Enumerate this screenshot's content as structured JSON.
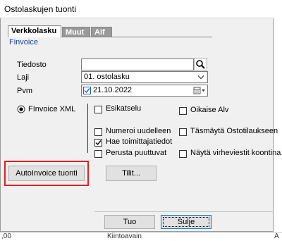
{
  "window": {
    "title": "Ostolaskujen tuonti"
  },
  "tabs": [
    {
      "label": "Verkkolasku",
      "active": true
    },
    {
      "label": "Muut",
      "active": false
    },
    {
      "label": "Aif",
      "active": false
    }
  ],
  "panel": {
    "title": "Finvoice"
  },
  "form": {
    "tiedosto_label": "Tiedosto",
    "tiedosto_value": "",
    "laji_label": "Laji",
    "laji_value": "01. ostolasku",
    "pvm_label": "Pvm",
    "pvm_value": "21.10.2022",
    "pvm_checked": true
  },
  "radio": {
    "label": "FInvoice XML",
    "selected": true
  },
  "checkboxes": [
    {
      "label": "Esikatselu",
      "checked": false
    },
    {
      "label": "Oikaise Alv",
      "checked": false
    },
    {
      "label": "Numeroi uudelleen",
      "checked": false
    },
    {
      "label": "Täsmäytä Ostotilaukseen",
      "checked": false
    },
    {
      "label": "Hae toimittajatiedot",
      "checked": true
    },
    {
      "label": "Perusta puuttuvat",
      "checked": false
    },
    {
      "label": "Näytä virheviestit koontina",
      "checked": false
    }
  ],
  "buttons": {
    "autoinvoice": "AutoInvoice tuonti",
    "tilit": "Tilit...",
    "tuo": "Tuo",
    "sulje": "Sulje"
  },
  "background": {
    "cell_left": ",00",
    "cell_mid": "Kiintoavain",
    "cell_right": "A"
  },
  "colors": {
    "highlight": "#e02020",
    "panel_title": "#1a3fa0",
    "check": "#1a5fb4"
  },
  "icons": [
    "search-icon",
    "chevron-down-icon",
    "calendar-icon",
    "radio-selected-icon",
    "checkmark-icon"
  ]
}
